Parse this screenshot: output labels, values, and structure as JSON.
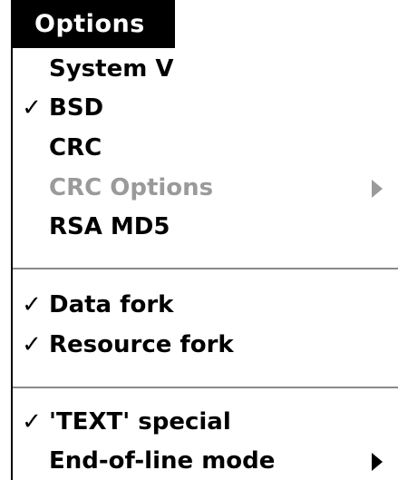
{
  "menu": {
    "title": "Options",
    "check_glyph": "✓",
    "items": [
      {
        "label": "System V",
        "checked": false,
        "disabled": false,
        "submenu": false,
        "check": ""
      },
      {
        "label": "BSD",
        "checked": true,
        "disabled": false,
        "submenu": false,
        "check": "✓"
      },
      {
        "label": "CRC",
        "checked": false,
        "disabled": false,
        "submenu": false,
        "check": ""
      },
      {
        "label": "CRC Options",
        "checked": false,
        "disabled": true,
        "submenu": true,
        "check": ""
      },
      {
        "label": "RSA MD5",
        "checked": false,
        "disabled": false,
        "submenu": false,
        "check": ""
      },
      {
        "label": "Data fork",
        "checked": true,
        "disabled": false,
        "submenu": false,
        "check": "✓"
      },
      {
        "label": "Resource fork",
        "checked": true,
        "disabled": false,
        "submenu": false,
        "check": "✓"
      },
      {
        "label": "'TEXT' special",
        "checked": true,
        "disabled": false,
        "submenu": false,
        "check": "✓"
      },
      {
        "label": "End-of-line mode",
        "checked": false,
        "disabled": false,
        "submenu": true,
        "check": ""
      }
    ]
  },
  "colors": {
    "title_bg": "#000000",
    "title_fg": "#ffffff",
    "disabled_text": "#9a9a9a",
    "separator": "#8a8a8a"
  },
  "icons": {
    "checkmark": "checkmark-icon",
    "submenu_arrow": "submenu-arrow-icon"
  }
}
